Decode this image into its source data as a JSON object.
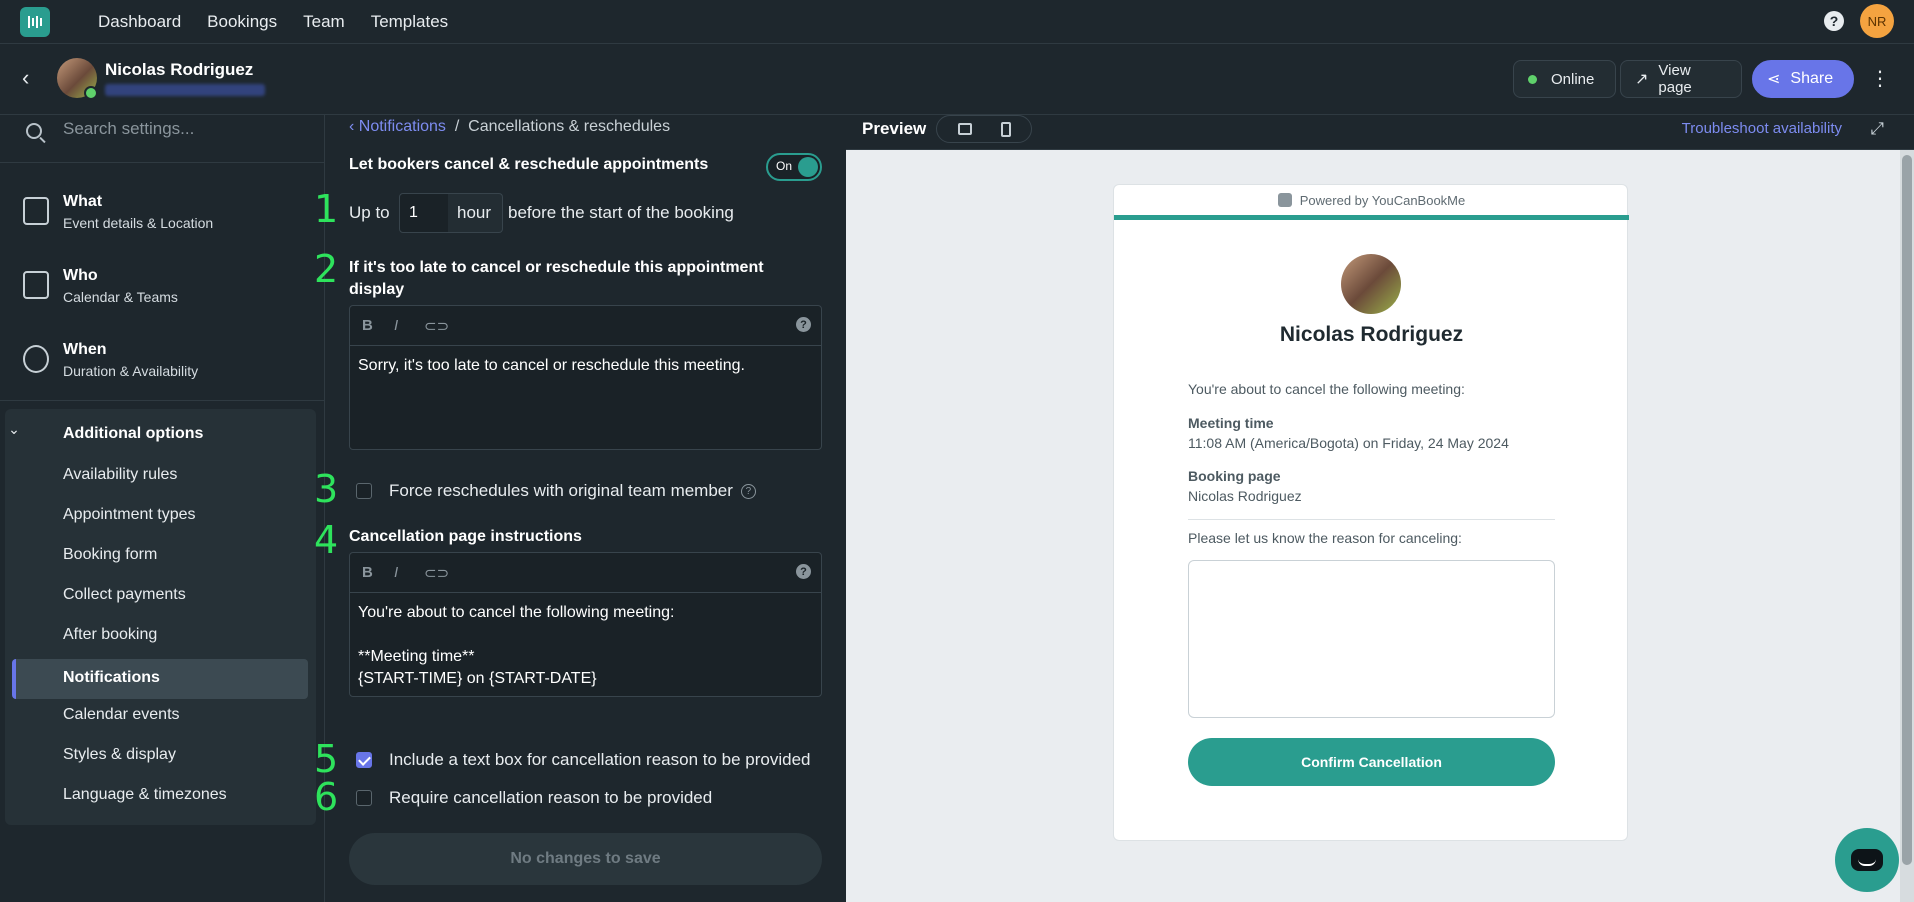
{
  "topnav": {
    "items": [
      "Dashboard",
      "Bookings",
      "Team",
      "Templates"
    ],
    "help_icon": "question-icon",
    "avatar_initials": "NR"
  },
  "header": {
    "name": "Nicolas Rodriguez",
    "online_label": "Online",
    "view_page_label": "View page",
    "share_label": "Share",
    "colors": {
      "online": "#5fd16b",
      "share_bg": "#6875e8"
    }
  },
  "sidebar": {
    "search_placeholder": "Search settings...",
    "sections": [
      {
        "title": "What",
        "subtitle": "Event details & Location",
        "icon": "id-card-icon"
      },
      {
        "title": "Who",
        "subtitle": "Calendar & Teams",
        "icon": "calendar-user-icon"
      },
      {
        "title": "When",
        "subtitle": "Duration & Availability",
        "icon": "watch-icon"
      }
    ],
    "additional": {
      "heading": "Additional options",
      "items": [
        "Availability rules",
        "Appointment types",
        "Booking form",
        "Collect payments",
        "After booking",
        "Notifications",
        "Calendar events",
        "Styles & display",
        "Language & timezones"
      ],
      "active": "Notifications"
    }
  },
  "form": {
    "breadcrumb_parent": "Notifications",
    "breadcrumb_separator": "/",
    "breadcrumb_current": "Cancellations & reschedules",
    "cancel_toggle_label": "Let bookers cancel & reschedule appointments",
    "cancel_toggle_state": "On",
    "upto_prefix": "Up to",
    "upto_value": "1",
    "upto_unit": "hour",
    "upto_suffix": "before the start of the booking",
    "too_late_label": "If it's too late to cancel or reschedule this appointment display",
    "too_late_text": "Sorry, it's too late to cancel or reschedule this meeting.",
    "force_reschedule_label": "Force reschedules with original team member",
    "force_reschedule_checked": false,
    "instructions_label": "Cancellation page instructions",
    "instructions_text": "You're about to cancel the following meeting:\n\n**Meeting time**\n{START-TIME} on {START-DATE}\n\n**Booking page**",
    "include_textbox_label": "Include a text box for cancellation reason to be provided",
    "include_textbox_checked": true,
    "require_reason_label": "Require cancellation reason to be provided",
    "require_reason_checked": false,
    "save_label": "No changes to save",
    "step_numbers": [
      "1",
      "2",
      "3",
      "4",
      "5",
      "6"
    ],
    "toolbar": {
      "bold": "B",
      "italic": "I",
      "help": "?"
    }
  },
  "preview": {
    "title": "Preview",
    "troubleshoot_label": "Troubleshoot availability",
    "powered_by": "Powered by YouCanBookMe",
    "name": "Nicolas Rodriguez",
    "intro": "You're about to cancel the following meeting:",
    "meeting_time_label": "Meeting time",
    "meeting_time_value": "11:08 AM (America/Bogota) on Friday, 24 May 2024",
    "booking_page_label": "Booking page",
    "booking_page_value": "Nicolas Rodriguez",
    "reason_prompt": "Please let us know the reason for canceling:",
    "confirm_label": "Confirm Cancellation",
    "accent_color": "#2a9d8f"
  }
}
